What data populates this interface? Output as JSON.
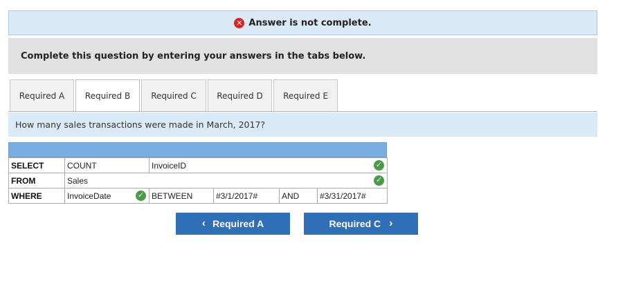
{
  "banner": {
    "text": "Answer is not complete.",
    "icon": "error-x-icon"
  },
  "instructions": "Complete this question by entering your answers in the tabs below.",
  "tabs": [
    {
      "label": "Required A"
    },
    {
      "label": "Required B",
      "active": true
    },
    {
      "label": "Required C"
    },
    {
      "label": "Required D"
    },
    {
      "label": "Required E"
    }
  ],
  "question": "How many sales transactions were made in March, 2017?",
  "sql": {
    "select": {
      "keyword": "SELECT",
      "func": "COUNT",
      "field": "InvoiceID",
      "correct": true
    },
    "from": {
      "keyword": "FROM",
      "table": "Sales",
      "correct": true
    },
    "where": {
      "keyword": "WHERE",
      "field": "InvoiceDate",
      "field_correct": true,
      "operator": "BETWEEN",
      "value1": "#3/1/2017#",
      "conj": "AND",
      "value2": "#3/31/2017#"
    }
  },
  "nav": {
    "prev_label": "Required A",
    "next_label": "Required C"
  },
  "colors": {
    "accent": "#2f6fb7",
    "header_blue": "#7aaee3",
    "correct_green": "#4a9a4a",
    "error_red": "#dd2222"
  }
}
